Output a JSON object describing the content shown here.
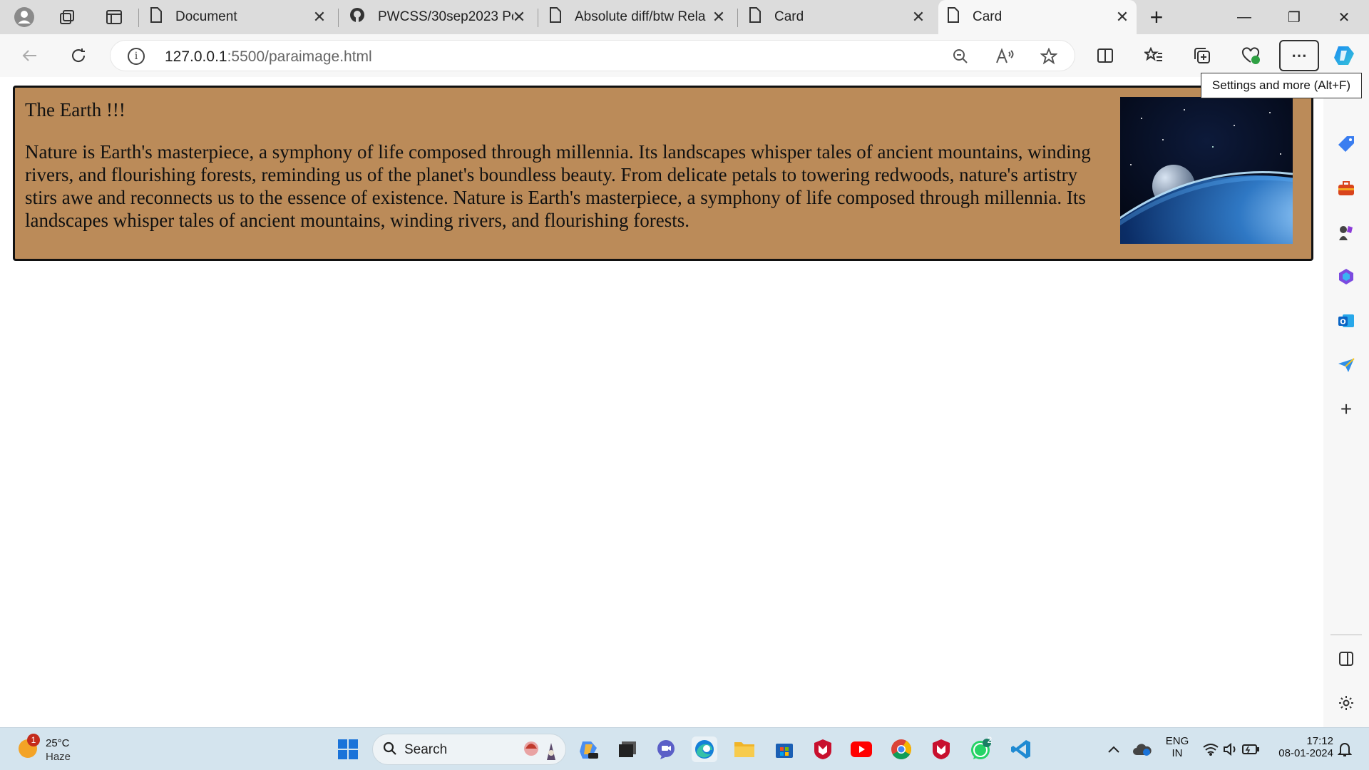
{
  "tabs": [
    {
      "title": "Document",
      "close": "✕",
      "active": false
    },
    {
      "title": "PWCSS/30sep2023 Po",
      "close": "✕",
      "active": false
    },
    {
      "title": "Absolute diff/btw Rela",
      "close": "✕",
      "active": false
    },
    {
      "title": "Card",
      "close": "✕",
      "active": false
    },
    {
      "title": "Card",
      "close": "✕",
      "active": true
    }
  ],
  "new_tab": "+",
  "window": {
    "minimize": "—",
    "restore": "❐",
    "close": "✕"
  },
  "address": {
    "host": "127.0.0.1",
    "path": ":5500/paraimage.html",
    "info": "i"
  },
  "tooltip": "Settings and more (Alt+F)",
  "card": {
    "title": "The Earth !!!",
    "text": "Nature is Earth's masterpiece, a symphony of life composed through millennia. Its landscapes whisper tales of ancient mountains, winding rivers, and flourishing forests, reminding us of the planet's boundless beauty. From delicate petals to towering redwoods, nature's artistry stirs awe and reconnects us to the essence of existence. Nature is Earth's masterpiece, a symphony of life composed through millennia. Its landscapes whisper tales of ancient mountains, winding rivers, and flourishing forests."
  },
  "taskbar": {
    "weather": {
      "temp": "25°C",
      "condition": "Haze",
      "badge": "1"
    },
    "search_label": "Search",
    "whatsapp_badge": "2",
    "language": {
      "line1": "ENG",
      "line2": "IN"
    },
    "clock": {
      "time": "17:12",
      "date": "08-01-2024"
    }
  },
  "colors": {
    "card_bg": "#bb8b59",
    "accent": "#0067c0"
  }
}
